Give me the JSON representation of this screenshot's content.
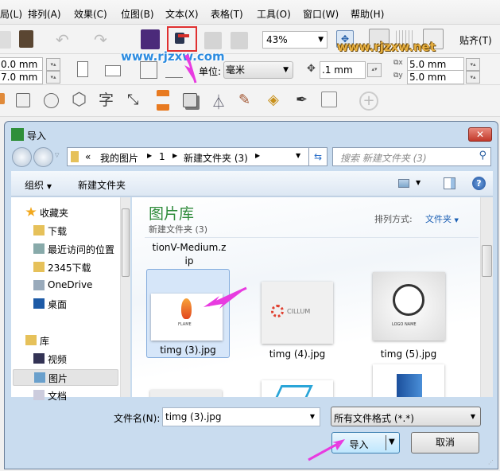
{
  "menu": [
    "局(L)",
    "排列(A)",
    "效果(C)",
    "位图(B)",
    "文本(X)",
    "表格(T)",
    "工具(O)",
    "窗口(W)",
    "帮助(H)"
  ],
  "toolbar1": {
    "zoom": "43%",
    "snap_label": "贴齐(T)"
  },
  "toolbar2": {
    "width": "0.0 mm",
    "height": "7.0 mm",
    "unit_label": "单位:",
    "unit_value": "毫米",
    "nudge": ".1 mm",
    "dup_x": "5.0 mm",
    "dup_y": "5.0 mm"
  },
  "watermarks": {
    "left": "www.rjzxw.com",
    "right": "www.rjzxw.net"
  },
  "dialog": {
    "title": "导入",
    "breadcrumb": [
      "«",
      "我的图片",
      "1",
      "新建文件夹 (3)"
    ],
    "search_placeholder": "搜索 新建文件夹 (3)",
    "organize": "组织",
    "new_folder": "新建文件夹",
    "nav": [
      {
        "label": "收藏夹",
        "icon": "star-icon"
      },
      {
        "label": "下载",
        "icon": "download-folder-icon"
      },
      {
        "label": "最近访问的位置",
        "icon": "recent-places-icon"
      },
      {
        "label": "2345下载",
        "icon": "folder-icon"
      },
      {
        "label": "OneDrive",
        "icon": "onedrive-icon"
      },
      {
        "label": "桌面",
        "icon": "desktop-icon"
      },
      {
        "label": "库",
        "icon": "library-icon"
      },
      {
        "label": "视频",
        "icon": "video-icon"
      },
      {
        "label": "图片",
        "icon": "pictures-icon"
      },
      {
        "label": "文档",
        "icon": "documents-icon"
      }
    ],
    "library_title": "图片库",
    "library_sub": "新建文件夹 (3)",
    "sort_label": "排列方式:",
    "sort_value": "文件夹",
    "partial_file": "tionV-Medium.z ip",
    "files": [
      {
        "name": "timg (3).jpg",
        "selected": true,
        "thumb_text": "FLAME"
      },
      {
        "name": "timg (4).jpg",
        "selected": false,
        "thumb_text": "CILLUM"
      },
      {
        "name": "timg (5).jpg",
        "selected": false,
        "thumb_text": "LOGO NAME"
      }
    ],
    "filename_label": "文件名(N):",
    "filename_value": "timg (3).jpg",
    "filetype_value": "所有文件格式 (*.*)",
    "import_button": "导入",
    "cancel_button": "取消"
  },
  "colors": {
    "accent_green": "#2e8b3a",
    "link_blue": "#1a5fb4",
    "annotation": "#e83be0",
    "highlight": "#e03030"
  }
}
